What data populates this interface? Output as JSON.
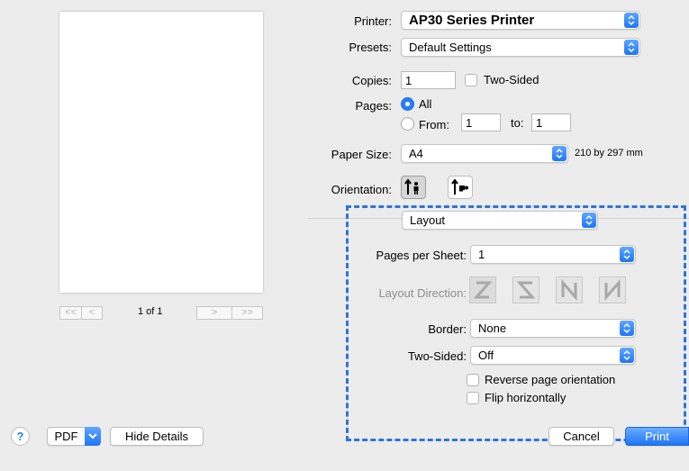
{
  "preview": {
    "page_indicator": "1 of 1",
    "first_label": "<<",
    "prev_label": "<",
    "next_label": ">",
    "last_label": ">>"
  },
  "printer": {
    "label": "Printer:",
    "value": "AP30 Series Printer"
  },
  "presets": {
    "label": "Presets:",
    "value": "Default Settings"
  },
  "copies": {
    "label": "Copies:",
    "value": "1",
    "two_sided_label": "Two-Sided"
  },
  "pages": {
    "label": "Pages:",
    "all_label": "All",
    "from_label": "From:",
    "from_value": "1",
    "to_label": "to:",
    "to_value": "1"
  },
  "paper_size": {
    "label": "Paper Size:",
    "value": "A4",
    "dimensions": "210 by 297 mm"
  },
  "orientation": {
    "label": "Orientation:"
  },
  "section_popup": {
    "value": "Layout"
  },
  "layout": {
    "pages_per_sheet_label": "Pages per Sheet:",
    "pages_per_sheet_value": "1",
    "layout_direction_label": "Layout Direction:",
    "border_label": "Border:",
    "border_value": "None",
    "two_sided_label": "Two-Sided:",
    "two_sided_value": "Off",
    "reverse_label": "Reverse page orientation",
    "flip_label": "Flip horizontally"
  },
  "footer": {
    "help_label": "?",
    "pdf_label": "PDF",
    "hide_details_label": "Hide Details",
    "cancel_label": "Cancel",
    "print_label": "Print"
  },
  "colors": {
    "accent": "#2a7ff6",
    "highlight": "#2f73dc"
  }
}
